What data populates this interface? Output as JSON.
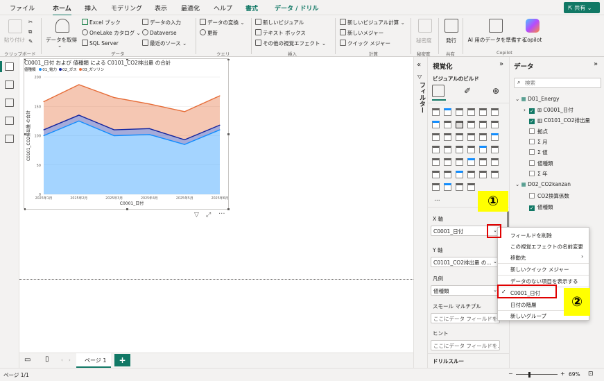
{
  "menu": {
    "tabs": [
      "ファイル",
      "ホーム",
      "挿入",
      "モデリング",
      "表示",
      "最適化",
      "ヘルプ",
      "書式",
      "データ / ドリル"
    ],
    "share": "共有"
  },
  "ribbon": {
    "clipboard": {
      "paste": "貼り付け",
      "group": "クリップボード"
    },
    "data": {
      "get_data": "データを取得",
      "excel": "Excel ブック",
      "onelake": "OneLake カタログ",
      "sql": "SQL Server",
      "enter_data": "データの入力",
      "dataverse": "Dataverse",
      "recent": "最近のソース",
      "group": "データ"
    },
    "query": {
      "transform": "データの変換",
      "refresh": "更新",
      "group": "クエリ"
    },
    "insert": {
      "new_visual": "新しいビジュアル",
      "textbox": "テキスト ボックス",
      "more_visuals": "その他の視覚エフェクト",
      "group": "挿入"
    },
    "calc": {
      "new_visual_calc": "新しいビジュアル計算",
      "new_measure": "新しいメジャー",
      "quick_measure": "クイック メジャー",
      "group": "計算"
    },
    "sensitivity": {
      "label": "秘密度",
      "group": "秘密度"
    },
    "share": {
      "publish": "発行",
      "group": "共有"
    },
    "copilot": {
      "prepare": "AI 用のデータを準備する",
      "ai": "AI",
      "copilot": "Copilot",
      "group": "Copilot"
    }
  },
  "visual": {
    "title": "C0001_日付 および 値種類 による C0101_CO2排出量 の合計",
    "legend_label": "値種類",
    "ylabel": "C0101_CO2排出量 の合計",
    "xlabel": "C0001_日付"
  },
  "chart_data": {
    "type": "area",
    "title": "C0001_日付 および 値種類 による C0101_CO2排出量 の合計",
    "xlabel": "C0001_日付",
    "ylabel": "C0101_CO2排出量 の合計",
    "categories": [
      "2025年1月",
      "2025年2月",
      "2025年3月",
      "2025年4月",
      "2025年5月",
      "2025年6月"
    ],
    "series": [
      {
        "name": "01_電力",
        "values": [
          100,
          125,
          100,
          102,
          85,
          110
        ],
        "color": "#118dff"
      },
      {
        "name": "02_ガス",
        "values": [
          10,
          10,
          10,
          10,
          8,
          8
        ],
        "color": "#12239e"
      },
      {
        "name": "03_ガソリン",
        "values": [
          48,
          52,
          55,
          42,
          48,
          50
        ],
        "color": "#e66c37"
      }
    ],
    "ylim": [
      0,
      200
    ],
    "yticks": [
      0,
      50,
      100,
      150,
      200
    ],
    "stacked": true,
    "grid": true,
    "legend_position": "top-left"
  },
  "canvas": {
    "page_tab": "ページ 1",
    "add_page": "+"
  },
  "status": {
    "page": "ページ 1/1",
    "zoom": "69%"
  },
  "filters": {
    "label": "フィルター"
  },
  "viz_pane": {
    "title": "視覚化",
    "build": "ビジュアルのビルド",
    "more": "...",
    "wells": [
      {
        "label": "X 軸",
        "value": "C0001_日付"
      },
      {
        "label": "Y 軸",
        "value": "C0101_CO2排出量 の..."
      },
      {
        "label": "凡例",
        "value": "値種類"
      },
      {
        "label": "スモール マルチプル",
        "value": "ここにデータ フィールドを"
      },
      {
        "label": "ヒント",
        "value": "ここにデータ フィールドを..."
      }
    ],
    "drill": "ドリルスルー"
  },
  "data_pane": {
    "title": "データ",
    "search_placeholder": "検索",
    "tree": [
      {
        "label": "D01_Energy",
        "level": 0,
        "type": "table"
      },
      {
        "label": "C0001_日付",
        "level": 1,
        "checked": true,
        "type": "hierarchy"
      },
      {
        "label": "C0101_CO2排出量",
        "level": 1,
        "checked": true,
        "type": "measure"
      },
      {
        "label": "拠点",
        "level": 1,
        "checked": false,
        "type": "field"
      },
      {
        "label": "月",
        "level": 1,
        "checked": false,
        "type": "sum"
      },
      {
        "label": "値",
        "level": 1,
        "checked": false,
        "type": "sum"
      },
      {
        "label": "値種類",
        "level": 1,
        "checked": false,
        "type": "field"
      },
      {
        "label": "年",
        "level": 1,
        "checked": false,
        "type": "sum"
      },
      {
        "label": "D02_CO2kanzan",
        "level": 0,
        "type": "table"
      },
      {
        "label": "CO2換算係数",
        "level": 1,
        "checked": false,
        "type": "field"
      },
      {
        "label": "値種類",
        "level": 1,
        "checked": true,
        "type": "field"
      }
    ]
  },
  "context_menu": {
    "items": [
      "フィールドを削除",
      "この視覚エフェクトの名前変更",
      "移動先",
      "新しいクイック メジャー",
      "データのない項目を表示する",
      "C0001_日付",
      "日付の階層",
      "新しいグループ"
    ]
  },
  "annotations": {
    "one": "①",
    "two": "②"
  }
}
